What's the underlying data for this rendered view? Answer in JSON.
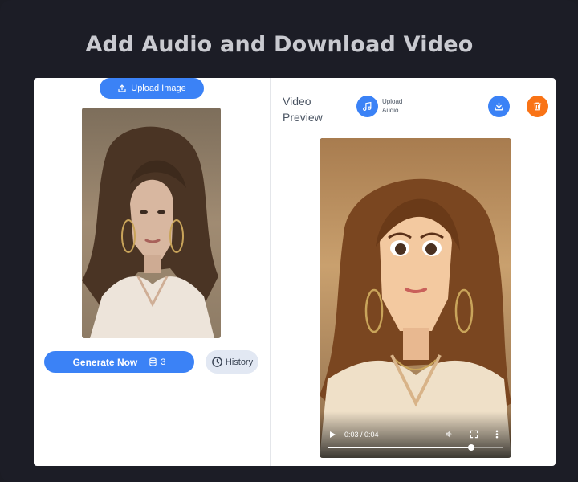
{
  "page": {
    "headline": "Add Audio and Download Video"
  },
  "left_panel": {
    "upload_image_label": "Upload Image",
    "generate_label": "Generate Now",
    "credits": "3",
    "history_label": "History"
  },
  "right_panel": {
    "title_line1": "Video",
    "title_line2": "Preview",
    "upload_audio_line1": "Upload",
    "upload_audio_line2": "Audio"
  },
  "video_player": {
    "time_display": "0:03 / 0:04",
    "progress_fraction": 0.82
  },
  "icons": {
    "upload": "upload-icon",
    "credits": "database-icon",
    "history": "clock-icon",
    "audio": "music-note-icon",
    "download": "download-icon",
    "delete": "trash-icon",
    "play": "play-icon",
    "volume": "volume-icon",
    "fullscreen": "fullscreen-icon",
    "more": "more-vertical-icon"
  },
  "colors": {
    "primary": "#3b82f6",
    "danger": "#f97316",
    "background": "#1b1c24"
  }
}
